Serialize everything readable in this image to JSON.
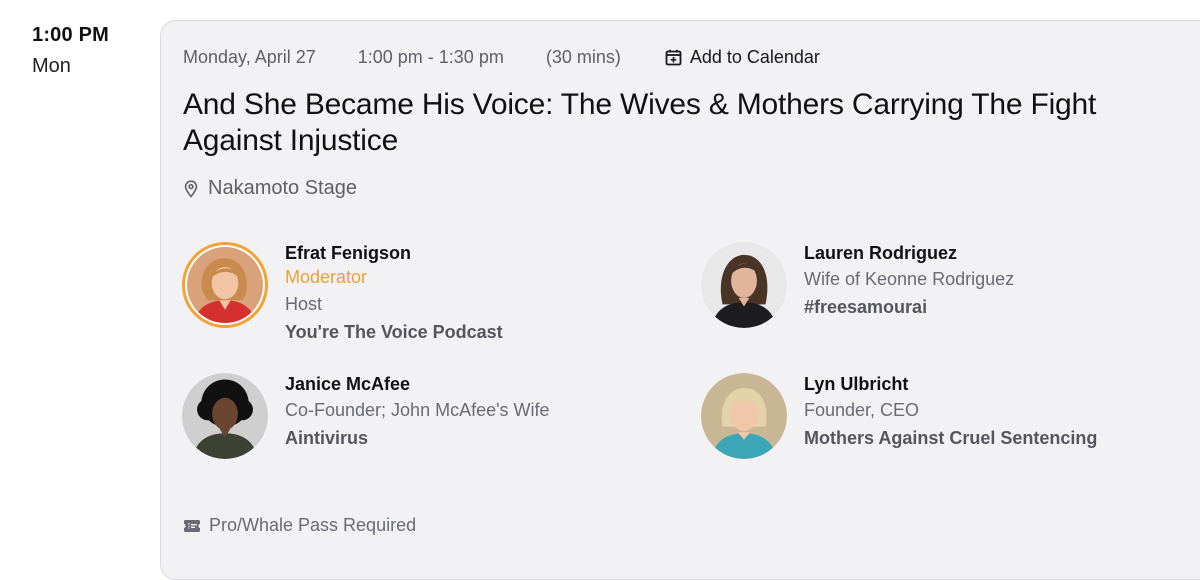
{
  "schedule": {
    "time": "1:00 PM",
    "day": "Mon"
  },
  "session": {
    "date": "Monday, April 27",
    "time_range": "1:00 pm - 1:30 pm",
    "duration": "(30 mins)",
    "add_to_calendar": "Add to Calendar",
    "title": "And She Became His Voice: The Wives & Mothers Carrying The Fight Against Injustice",
    "location": "Nakamoto Stage",
    "pass_required": "Pro/Whale Pass Required"
  },
  "speakers": [
    {
      "name": "Efrat Fenigson",
      "role": "Moderator",
      "title": "Host",
      "org": "You're The Voice Podcast",
      "avatar_icon": "person-avatar-icon",
      "colors": {
        "bg": "#d9a27a",
        "hair": "#c98a4e",
        "shirt": "#d62f2f",
        "skin": "#f0c4a4"
      }
    },
    {
      "name": "Lauren Rodriguez",
      "title": "Wife of Keonne Rodriguez",
      "org": "#freesamourai",
      "avatar_icon": "person-avatar-icon",
      "colors": {
        "bg": "#e8e8e8",
        "hair": "#4a3426",
        "shirt": "#1d1d1f",
        "skin": "#e2b49a"
      }
    },
    {
      "name": "Janice McAfee",
      "title": "Co-Founder; John McAfee's Wife",
      "org": "Aintivirus",
      "avatar_icon": "person-avatar-icon",
      "colors": {
        "bg": "#cfcfcf",
        "hair": "#111111",
        "shirt": "#3d4133",
        "skin": "#6a4530"
      }
    },
    {
      "name": "Lyn Ulbricht",
      "title": "Founder, CEO",
      "org": "Mothers Against Cruel Sentencing",
      "avatar_icon": "person-avatar-icon",
      "colors": {
        "bg": "#c9b694",
        "hair": "#e4d2a8",
        "shirt": "#3aa6b8",
        "skin": "#f0c7a8"
      }
    }
  ],
  "colors": {
    "accent_moderator": "#f0a030",
    "card_bg": "#f2f2f5",
    "muted_text": "#5f5f66"
  }
}
